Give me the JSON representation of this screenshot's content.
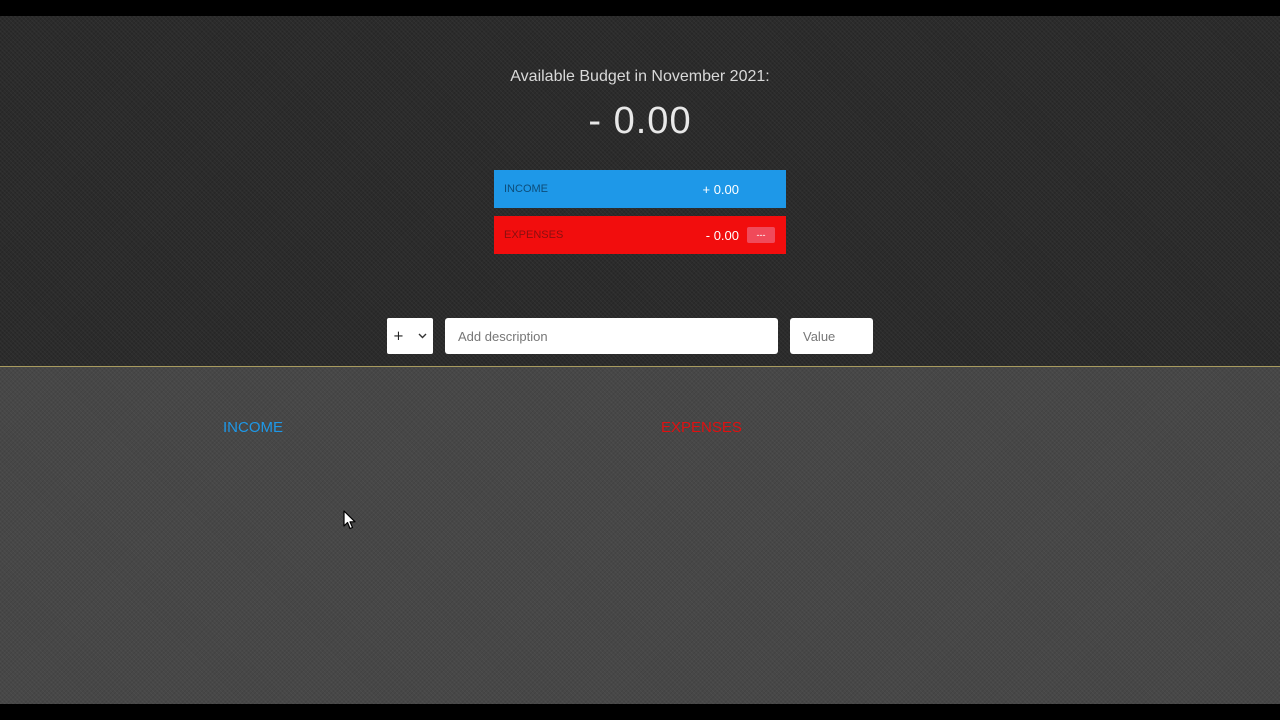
{
  "budget": {
    "title": "Available Budget in November 2021:",
    "value": "- 0.00"
  },
  "summary": {
    "income_label": "INCOME",
    "income_value": "+ 0.00",
    "expenses_label": "EXPENSES",
    "expenses_value": "- 0.00",
    "expenses_percentage": "---"
  },
  "add_form": {
    "type_selected": "+",
    "description_placeholder": "Add description",
    "value_placeholder": "Value"
  },
  "lists": {
    "income_title": "INCOME",
    "expenses_title": "EXPENSES"
  },
  "colors": {
    "income": "#1e98e8",
    "expenses": "#f20d0d"
  }
}
